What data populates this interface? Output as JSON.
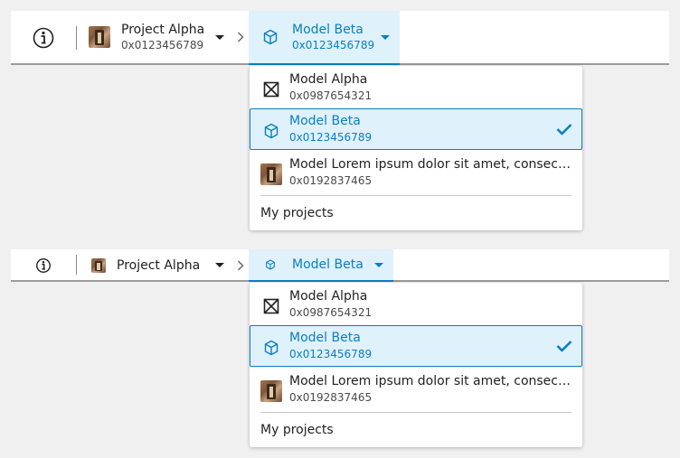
{
  "bars": [
    {
      "info_icon": "info-circle-icon",
      "project": {
        "name": "Project Alpha",
        "id": "0x0123456789"
      },
      "model": {
        "name": "Model Beta",
        "id": "0x0123456789"
      }
    },
    {
      "info_icon": "info-circle-icon",
      "project": {
        "name": "Project Alpha"
      },
      "model": {
        "name": "Model Beta"
      }
    }
  ],
  "menus": [
    {
      "items": [
        {
          "name": "Model Alpha",
          "id": "0x0987654321",
          "icon": "no-image-icon"
        },
        {
          "name": "Model Beta",
          "id": "0x0123456789",
          "icon": "cube-icon",
          "selected": true
        },
        {
          "name": "Model Lorem ipsum dolor sit amet, consectetur adipiscing elit",
          "id": "0x0192837465",
          "icon": "thumbnail"
        }
      ],
      "footer_link": "My projects"
    },
    {
      "items": [
        {
          "name": "Model Alpha",
          "id": "0x0987654321",
          "icon": "no-image-icon"
        },
        {
          "name": "Model Beta",
          "id": "0x0123456789",
          "icon": "cube-icon",
          "selected": true
        },
        {
          "name": "Model Lorem ipsum dolor sit amet, consectetur adipiscing elit",
          "id": "0x0192837465",
          "icon": "thumbnail"
        }
      ],
      "footer_link": "My projects"
    }
  ],
  "colors": {
    "accent": "#0a7fc2",
    "selected_bg": "#dff1fb",
    "page_bg": "#f0f0f0"
  }
}
